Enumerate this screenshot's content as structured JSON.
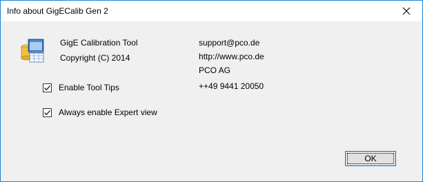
{
  "window": {
    "title": "Info about GigECalib Gen 2"
  },
  "app_info": {
    "name": "GigE Calibration Tool",
    "copyright": "Copyright (C) 2014",
    "icon": "application-window-icon"
  },
  "contact": {
    "email": "support@pco.de",
    "website": "http://www.pco.de",
    "company": "PCO AG",
    "phone": "++49 9441 20050"
  },
  "options": [
    {
      "label": "Enable Tool Tips",
      "checked": true
    },
    {
      "label": "Always enable Expert view",
      "checked": true
    }
  ],
  "buttons": {
    "ok_label": "OK"
  },
  "colors": {
    "accent": "#0078d7",
    "window_border": "#1883d7",
    "dialog_background": "#f0f0f0"
  }
}
